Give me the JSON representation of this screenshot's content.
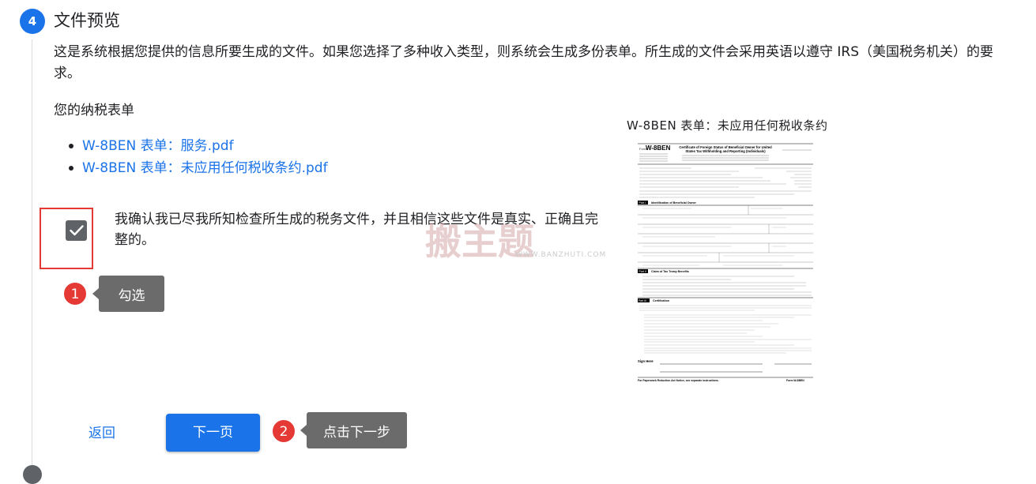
{
  "step": {
    "number": "4",
    "title": "文件预览",
    "description": "这是系统根据您提供的信息所要生成的文件。如果您选择了多种收入类型，则系统会生成多份表单。所生成的文件会采用英语以遵守 IRS（美国税务机关）的要求。"
  },
  "forms": {
    "heading": "您的纳税表单",
    "documents": [
      {
        "label": "W-8BEN 表单：服务.pdf"
      },
      {
        "label": "W-8BEN 表单：未应用任何税收条约.pdf"
      }
    ]
  },
  "confirmation": {
    "checked": true,
    "text": "我确认我已尽我所知检查所生成的税务文件，并且相信这些文件是真实、正确且完整的。"
  },
  "preview": {
    "title": "W-8BEN 表单：未应用任何税收条约",
    "document": {
      "form_name": "W-8BEN",
      "heading_line1": "Certificate of Foreign Status of Beneficial Owner for United",
      "heading_line2": "States Tax Withholding and Reporting (Individuals)",
      "part1": "Part I",
      "part1_title": "Identification of Beneficial Owner",
      "part2": "Part II",
      "part2_title": "Claim of Tax Treaty Benefits",
      "part3": "Part III",
      "part3_title": "Certification",
      "sign_here": "Sign Here",
      "footer_left": "For Paperwork Reduction Act Notice, see separate instructions.",
      "footer_right": "Form W-8BEN"
    }
  },
  "watermark": {
    "text": "搬主题",
    "url": "WWW.BANZHUTI.COM"
  },
  "annotations": [
    {
      "number": "1",
      "label": "勾选"
    },
    {
      "number": "2",
      "label": "点击下一步"
    }
  ],
  "actions": {
    "back_label": "返回",
    "next_label": "下一页"
  },
  "colors": {
    "primary": "#1a73e8",
    "callout_number": "#e53935",
    "callout_bg": "#6b6b6b",
    "highlight_border": "#e53935"
  }
}
